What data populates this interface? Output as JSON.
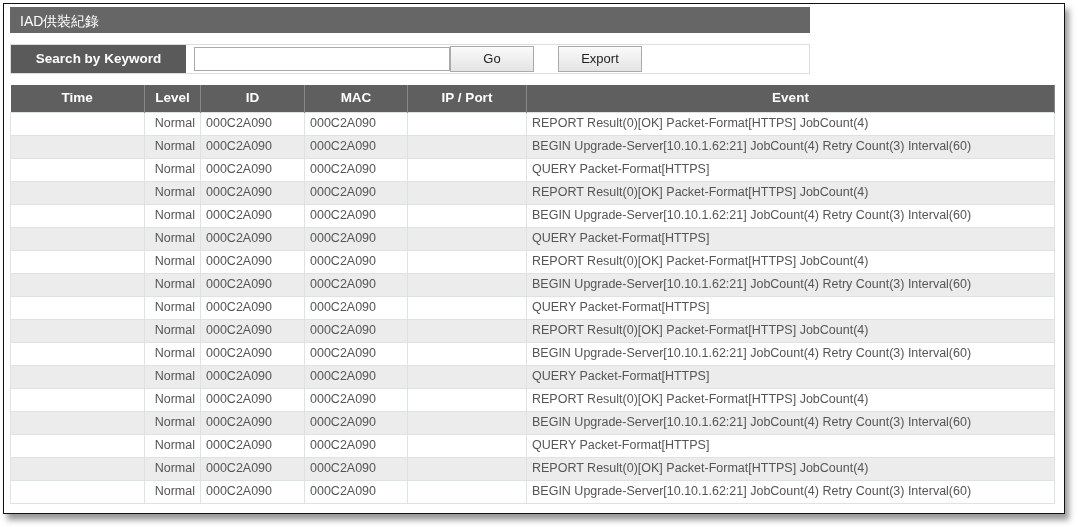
{
  "title": "IAD供裝紀錄",
  "search": {
    "label": "Search by Keyword",
    "go": "Go",
    "export": "Export"
  },
  "table": {
    "columns": [
      "Time",
      "Level",
      "ID",
      "MAC",
      "IP / Port",
      "Event"
    ],
    "rows": [
      {
        "level": "Normal",
        "id": "000C2A090",
        "mac": "000C2A090",
        "event": "REPORT Result(0)[OK] Packet-Format[HTTPS] JobCount(4)"
      },
      {
        "level": "Normal",
        "id": "000C2A090",
        "mac": "000C2A090",
        "event": "BEGIN Upgrade-Server[10.10.1.62:21] JobCount(4) Retry Count(3) Interval(60)"
      },
      {
        "level": "Normal",
        "id": "000C2A090",
        "mac": "000C2A090",
        "event": "QUERY Packet-Format[HTTPS]"
      },
      {
        "level": "Normal",
        "id": "000C2A090",
        "mac": "000C2A090",
        "event": "REPORT Result(0)[OK] Packet-Format[HTTPS] JobCount(4)"
      },
      {
        "level": "Normal",
        "id": "000C2A090",
        "mac": "000C2A090",
        "event": "BEGIN Upgrade-Server[10.10.1.62:21] JobCount(4) Retry Count(3) Interval(60)"
      },
      {
        "level": "Normal",
        "id": "000C2A090",
        "mac": "000C2A090",
        "event": "QUERY Packet-Format[HTTPS]"
      },
      {
        "level": "Normal",
        "id": "000C2A090",
        "mac": "000C2A090",
        "event": "REPORT Result(0)[OK] Packet-Format[HTTPS] JobCount(4)"
      },
      {
        "level": "Normal",
        "id": "000C2A090",
        "mac": "000C2A090",
        "event": "BEGIN Upgrade-Server[10.10.1.62:21] JobCount(4) Retry Count(3) Interval(60)"
      },
      {
        "level": "Normal",
        "id": "000C2A090",
        "mac": "000C2A090",
        "event": "QUERY Packet-Format[HTTPS]"
      },
      {
        "level": "Normal",
        "id": "000C2A090",
        "mac": "000C2A090",
        "event": "REPORT Result(0)[OK] Packet-Format[HTTPS] JobCount(4)"
      },
      {
        "level": "Normal",
        "id": "000C2A090",
        "mac": "000C2A090",
        "event": "BEGIN Upgrade-Server[10.10.1.62:21] JobCount(4) Retry Count(3) Interval(60)"
      },
      {
        "level": "Normal",
        "id": "000C2A090",
        "mac": "000C2A090",
        "event": "QUERY Packet-Format[HTTPS]"
      },
      {
        "level": "Normal",
        "id": "000C2A090",
        "mac": "000C2A090",
        "event": "REPORT Result(0)[OK] Packet-Format[HTTPS] JobCount(4)"
      },
      {
        "level": "Normal",
        "id": "000C2A090",
        "mac": "000C2A090",
        "event": "BEGIN Upgrade-Server[10.10.1.62:21] JobCount(4) Retry Count(3) Interval(60)"
      },
      {
        "level": "Normal",
        "id": "000C2A090",
        "mac": "000C2A090",
        "event": "QUERY Packet-Format[HTTPS]"
      },
      {
        "level": "Normal",
        "id": "000C2A090",
        "mac": "000C2A090",
        "event": "REPORT Result(0)[OK] Packet-Format[HTTPS] JobCount(4)"
      },
      {
        "level": "Normal",
        "id": "000C2A090",
        "mac": "000C2A090",
        "event": "BEGIN Upgrade-Server[10.10.1.62:21] JobCount(4) Retry Count(3) Interval(60)"
      }
    ]
  }
}
